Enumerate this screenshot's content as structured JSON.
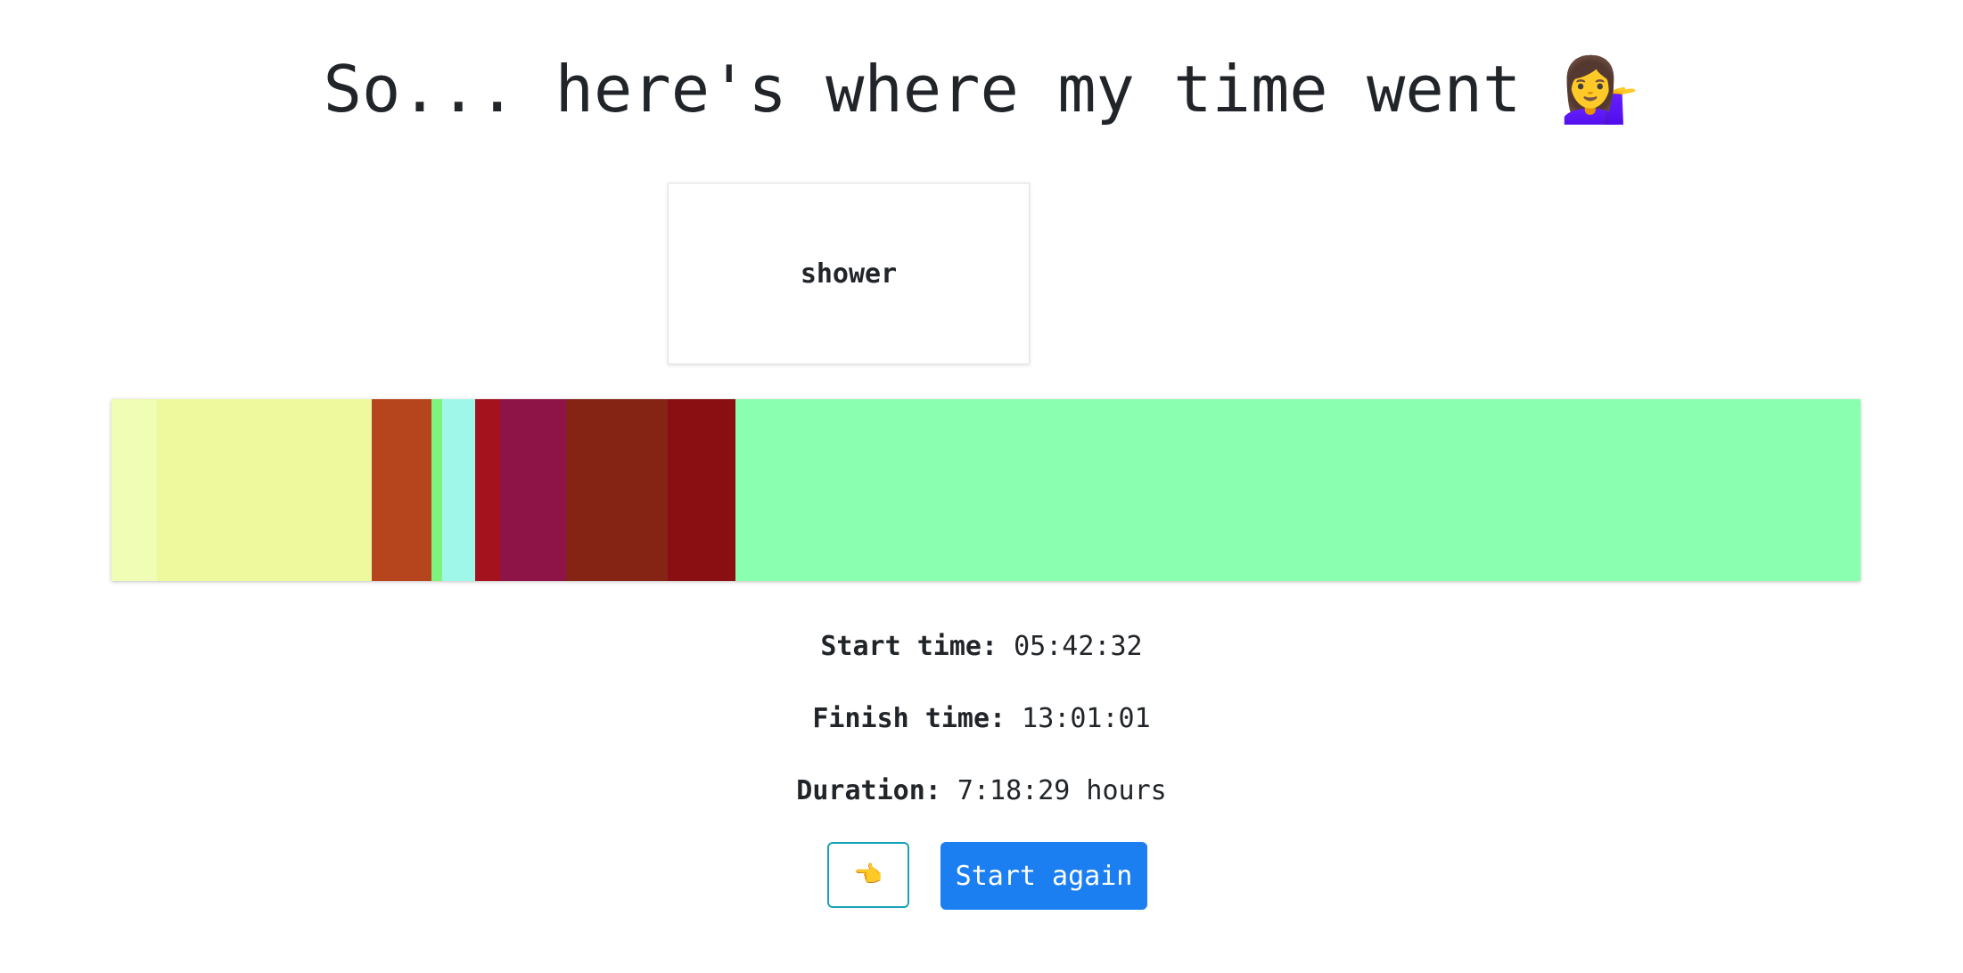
{
  "header": {
    "title": "So... here's where my time went",
    "title_emoji": "💁‍♀️"
  },
  "tooltip": {
    "label": "shower"
  },
  "timeline": {
    "segments": [
      {
        "color": "#effdb5",
        "share": 2.6
      },
      {
        "color": "#edf99c",
        "share": 12.3
      },
      {
        "color": "#b6441d",
        "share": 3.4
      },
      {
        "color": "#7ef47e",
        "share": 0.6
      },
      {
        "color": "#9ff7e9",
        "share": 1.9
      },
      {
        "color": "#a4131d",
        "share": 1.4
      },
      {
        "color": "#8e1346",
        "share": 3.8
      },
      {
        "color": "#852415",
        "share": 5.8
      },
      {
        "color": "#890f13",
        "share": 3.9
      },
      {
        "color": "#89ffaf",
        "share": 64.3
      }
    ]
  },
  "stats": {
    "start_label": "Start time:",
    "start_value": "05:42:32",
    "finish_label": "Finish time:",
    "finish_value": "13:01:01",
    "duration_label": "Duration:",
    "duration_value": "7:18:29 hours"
  },
  "actions": {
    "back_icon": "👈",
    "back_icon_name": "pointing-left-hand-icon",
    "restart_label": "Start again",
    "restart_color": "#1b7ff2",
    "back_border_color": "#17a2b8"
  }
}
